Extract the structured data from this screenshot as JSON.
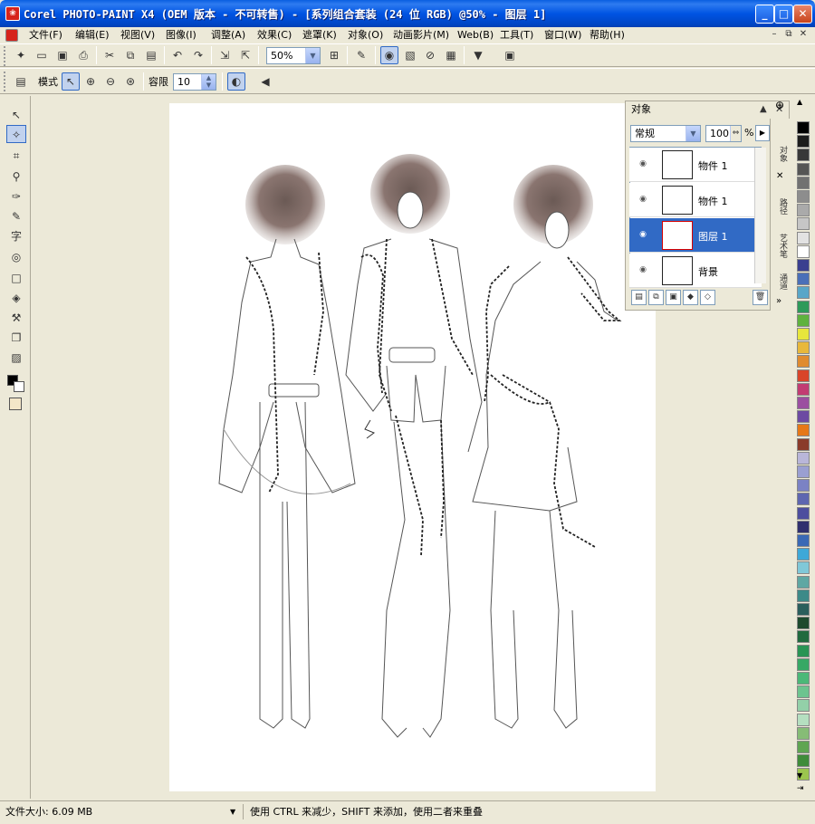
{
  "window": {
    "title": "Corel PHOTO-PAINT X4 (OEM 版本 - 不可转售) - [系列组合套装 (24 位 RGB) @50% - 图层 1]",
    "minimize": "_",
    "maximize": "□",
    "close": "✕"
  },
  "menu": {
    "items": [
      "文件(F)",
      "编辑(E)",
      "视图(V)",
      "图像(I)",
      "调整(A)",
      "效果(C)",
      "遮罩(K)",
      "对象(O)",
      "动画影片(M)",
      "Web(B)",
      "工具(T)",
      "窗口(W)",
      "帮助(H)"
    ],
    "mdi_min": "–",
    "mdi_restore": "⧉",
    "mdi_close": "✕"
  },
  "standard_toolbar": {
    "zoom_value": "50%"
  },
  "property_bar": {
    "mode_label": "模式",
    "tolerance_label": "容限",
    "tolerance_value": "10"
  },
  "objects_docker": {
    "title": "对象",
    "merge_mode": "常规",
    "opacity": "100",
    "opacity_unit": "%",
    "layers": [
      {
        "name": "物件 1",
        "visible": true,
        "selected": false
      },
      {
        "name": "物件 1",
        "visible": true,
        "selected": false
      },
      {
        "name": "图层 1",
        "visible": true,
        "selected": true
      },
      {
        "name": "背景",
        "visible": true,
        "selected": false
      }
    ]
  },
  "dock_tabs": [
    "对象",
    "路径",
    "艺术笔",
    "通道"
  ],
  "palette": {
    "colors": [
      "#000000",
      "#1c1c1c",
      "#383838",
      "#555555",
      "#717171",
      "#8d8d8d",
      "#aaaaaa",
      "#c6c6c6",
      "#e2e2e2",
      "#ffffff",
      "#3a3f8f",
      "#4a6fb8",
      "#58a6c8",
      "#2e9a5a",
      "#5fb23e",
      "#e7e63c",
      "#e8b83b",
      "#e08b2f",
      "#d9452a",
      "#c23c72",
      "#9b4fa0",
      "#6c4aa2",
      "#e67817",
      "#8a3b2a",
      "#b9b6d9",
      "#9a9fd1",
      "#7b82c4",
      "#5e66b0",
      "#4d4e9e",
      "#30306e",
      "#3a69b5",
      "#3ea8d8",
      "#80c8d8",
      "#5fa7a3",
      "#3d8a88",
      "#2a5e5c",
      "#1d4a2e",
      "#206a3e",
      "#299454",
      "#37a865",
      "#4bb878",
      "#6dc48f",
      "#93d0a8",
      "#b5dfc0",
      "#86bc76",
      "#5fa552",
      "#3f8c3a",
      "#9bc54e"
    ],
    "scroll_up": "▲",
    "scroll_down": "▼"
  },
  "status": {
    "file_size": "文件大小: 6.09 MB",
    "hint": "使用 CTRL 来减少，SHIFT 来添加，使用二者来重叠"
  },
  "icons": {
    "pick": "pick-tool-icon",
    "mask": "magic-wand-mask-icon",
    "crop": "crop-icon",
    "zoom": "zoom-icon",
    "eyedropper": "eyedropper-icon",
    "paint": "paint-brush-icon",
    "text": "text-tool-icon",
    "effect": "effect-tool-icon",
    "rect": "rectangle-tool-icon",
    "fill": "fill-tool-icon",
    "clone": "clone-tool-icon",
    "shadow": "drop-shadow-icon",
    "transparency": "transparency-tool-icon"
  }
}
